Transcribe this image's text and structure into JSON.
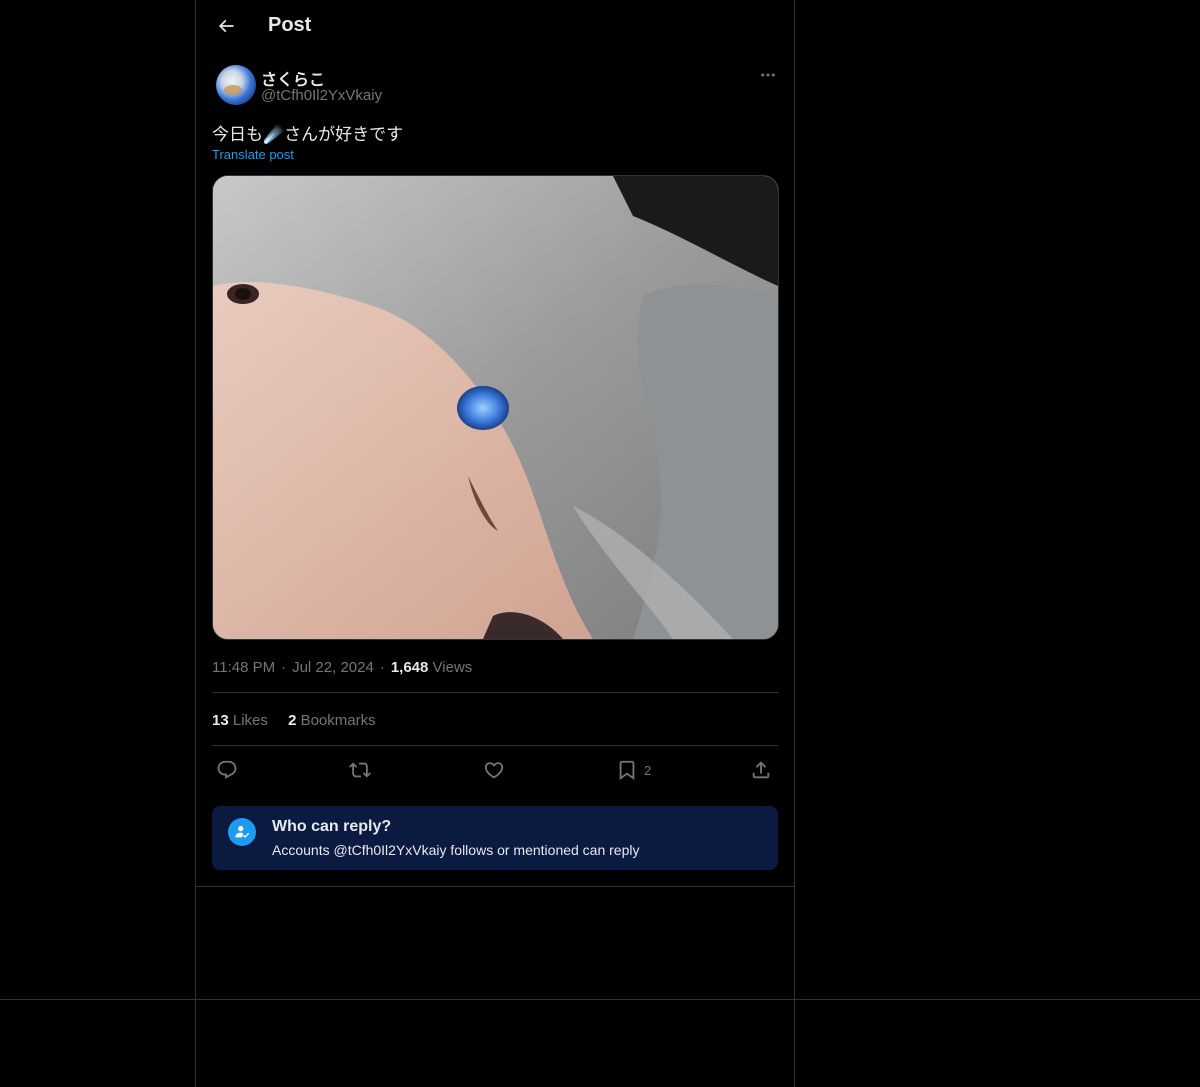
{
  "header": {
    "back_icon": "arrow-left-icon",
    "title": "Post"
  },
  "author": {
    "display_name": "さくらこ",
    "handle": "@tCfh0Il2YxVkaiy",
    "avatar_icon": "earth-globe-avatar"
  },
  "post": {
    "text": "今日も☄️さんが好きです",
    "translate_label": "Translate post",
    "media_description_icon": "photo-media",
    "time": "11:48 PM",
    "date": "Jul 22, 2024",
    "views_count": "1,648",
    "views_label": "Views"
  },
  "stats": {
    "likes_count": "13",
    "likes_label": "Likes",
    "bookmarks_count": "2",
    "bookmarks_label": "Bookmarks"
  },
  "actions": {
    "reply_icon": "reply-icon",
    "repost_icon": "repost-icon",
    "like_icon": "heart-icon",
    "bookmark_icon": "bookmark-icon",
    "bookmark_count": "2",
    "share_icon": "share-icon"
  },
  "who_can_reply": {
    "title": "Who can reply?",
    "description": "Accounts @tCfh0Il2YxVkaiy follows or mentioned can reply"
  },
  "colors": {
    "background": "#000000",
    "accent": "#1d9bf0",
    "text_primary": "#e7e9ea",
    "text_secondary": "#71767b",
    "border": "#2f3336",
    "reply_box_bg": "#0a1a40"
  }
}
